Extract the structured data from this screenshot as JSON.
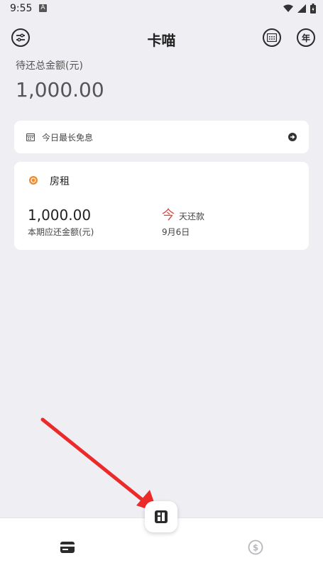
{
  "status": {
    "time": "9:55",
    "notif_badge": "A"
  },
  "header": {
    "title": "卡喵",
    "left_icon": "sliders-icon",
    "right_icon_1": "calendar-grid-icon",
    "right_icon_2": "year-icon",
    "year_label": "年"
  },
  "summary": {
    "label": "待还总金额(元)",
    "amount": "1,000.00"
  },
  "free_card": {
    "label": "今日最长免息"
  },
  "bill_card": {
    "name": "房租",
    "amount": "1,000.00",
    "amount_label": "本期应还金额(元)",
    "due_today_char": "今",
    "due_suffix": "天还款",
    "due_date": "9月6日"
  },
  "colors": {
    "accent_red": "#e14b4b",
    "orange": "#f28b2d"
  },
  "bottom_nav": {
    "left_icon": "card-icon",
    "center_icon": "grid-icon",
    "right_icon": "dollar-circle-icon"
  }
}
